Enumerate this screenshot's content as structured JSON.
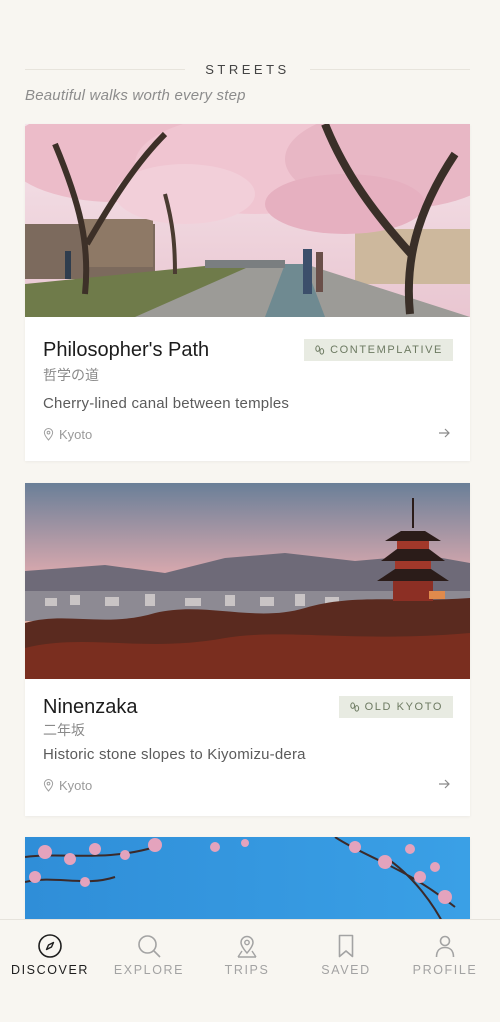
{
  "section": {
    "title": "STREETS",
    "subtitle": "Beautiful walks worth every step"
  },
  "cards": [
    {
      "title": "Philosopher's Path",
      "subtitle": "哲学の道",
      "description": "Cherry-lined canal between temples",
      "location": "Kyoto",
      "tag": "CONTEMPLATIVE"
    },
    {
      "title": "Ninenzaka",
      "subtitle": "二年坂",
      "description": "Historic stone slopes to Kiyomizu-dera",
      "location": "Kyoto",
      "tag": "OLD KYOTO"
    }
  ],
  "nav": {
    "active": "discover",
    "items": [
      {
        "id": "discover",
        "label": "DISCOVER",
        "icon": "compass-icon"
      },
      {
        "id": "explore",
        "label": "EXPLORE",
        "icon": "search-icon"
      },
      {
        "id": "trips",
        "label": "TRIPS",
        "icon": "map-pin-icon"
      },
      {
        "id": "saved",
        "label": "SAVED",
        "icon": "bookmark-icon"
      },
      {
        "id": "profile",
        "label": "PROFILE",
        "icon": "user-icon"
      }
    ]
  },
  "colors": {
    "background": "#f8f6f1",
    "tag_bg": "#e8ebe2",
    "tag_text": "#6d7a62",
    "active_nav": "#1e1e1e",
    "inactive_nav": "#a3a3a3"
  }
}
